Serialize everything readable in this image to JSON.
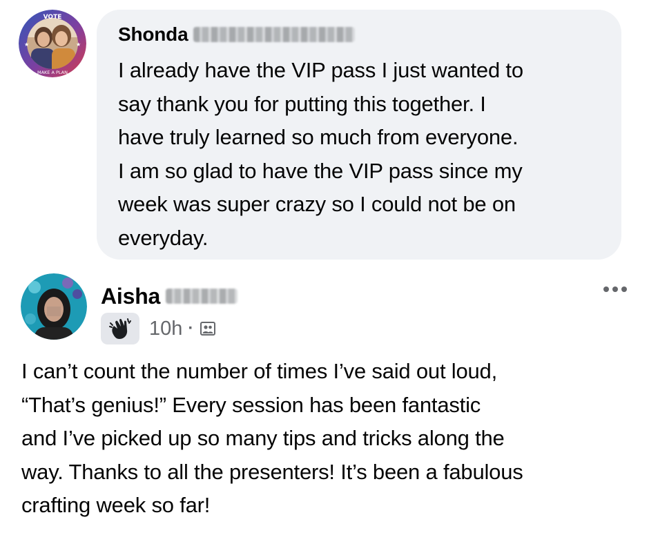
{
  "comments": [
    {
      "author": {
        "first_name": "Shonda"
      },
      "avatar": {
        "ring_text_top": "VOTE",
        "ring_text_bottom": "MAKE A PLAN",
        "ring_colors": [
          "#d63c4c",
          "#3157b8"
        ]
      },
      "text": "I already have the VIP pass I just wanted to\nsay thank you for putting this together.   I\nhave truly learned so much from everyone.\nI am so glad to have the VIP pass since my\nweek was super crazy so I could not be on\neveryday."
    },
    {
      "author": {
        "first_name": "Aisha"
      },
      "badge_icon": "waving-hand-icon",
      "timestamp": "10h",
      "separator": "·",
      "audience_icon": "group-audience-icon",
      "more_icon": "more-options-icon",
      "text": "I can’t count the number of times I’ve said out loud,\n“That’s genius!” Every session has been fantastic\nand I’ve picked up so many tips and tricks along the\nway. Thanks to all the presenters! It’s been a fabulous\ncrafting week so far!"
    }
  ]
}
